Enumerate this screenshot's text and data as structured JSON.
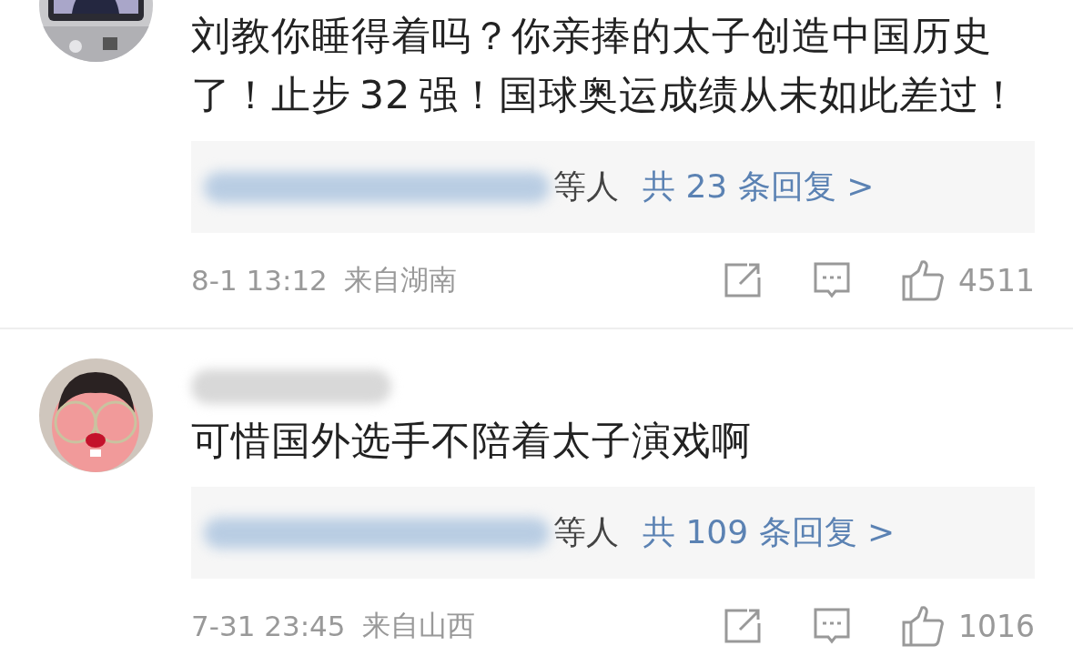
{
  "comments": [
    {
      "username_redacted": false,
      "text": "刘教你睡得着吗？你亲捧的太子创造中国历史了！止步 32 强！国球奥运成绩从未如此差过！",
      "replies": {
        "names_redacted": true,
        "suffix": "等人",
        "summary": "共 23 条回复 >"
      },
      "time": "8-1 13:12",
      "location": "来自湖南",
      "likes": "4511"
    },
    {
      "username_redacted": true,
      "text": "可惜国外选手不陪着太子演戏啊",
      "replies": {
        "names_redacted": true,
        "suffix": "等人",
        "summary": "共 109 条回复 >"
      },
      "time": "7-31 23:45",
      "location": "来自山西",
      "likes": "1016"
    }
  ]
}
